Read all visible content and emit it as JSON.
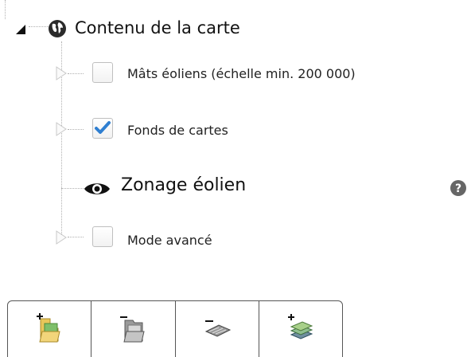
{
  "tree": {
    "root": {
      "label": "Contenu de la carte",
      "expanded": true,
      "icon": "globe-icon"
    },
    "items": [
      {
        "label": "Mâts éoliens (échelle min. 200 000)",
        "checked": false,
        "icon": "checkbox"
      },
      {
        "label": "Fonds de cartes",
        "checked": true,
        "icon": "checkbox"
      },
      {
        "label": "Zonage éolien",
        "visible": true,
        "icon": "eye-icon",
        "help_icon": "question-circle-icon"
      },
      {
        "label": "Mode avancé",
        "checked": false,
        "icon": "checkbox"
      }
    ]
  },
  "toolbar": {
    "buttons": [
      {
        "name": "add-folder",
        "icon": "folder-add-icon"
      },
      {
        "name": "remove-folder",
        "icon": "folder-remove-icon"
      },
      {
        "name": "remove-layer",
        "icon": "layer-remove-icon"
      },
      {
        "name": "add-layer",
        "icon": "layers-add-icon"
      }
    ]
  },
  "colors": {
    "check_blue": "#2f7fd1",
    "tree_line": "#b0b0b0",
    "icon_dark": "#333333",
    "help_icon": "#666666"
  }
}
